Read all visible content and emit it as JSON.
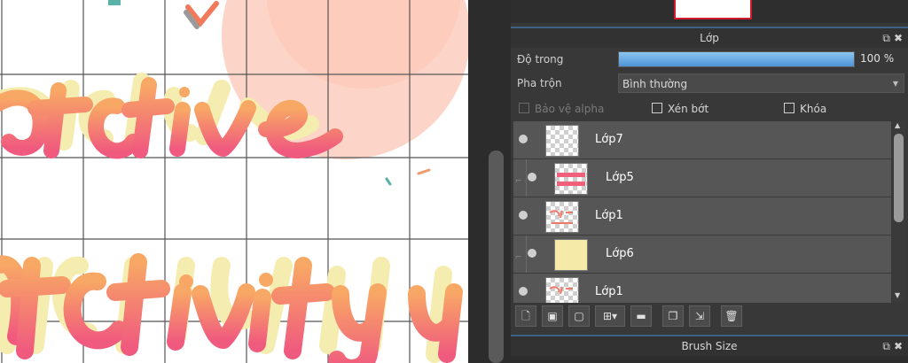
{
  "layer_panel": {
    "title": "Lớp",
    "opacity_label": "Độ trong",
    "opacity_value": "100 %",
    "opacity_level": 1.0,
    "blend_label": "Pha trộn",
    "blend_value": "Bình thường",
    "checkboxes": {
      "protect_alpha": "Bảo vệ alpha",
      "clip": "Xén bớt",
      "lock": "Khóa"
    },
    "layers": [
      {
        "name": "Lớp7",
        "clipped": false
      },
      {
        "name": "Lớp5",
        "clipped": true
      },
      {
        "name": "Lớp1",
        "clipped": false
      },
      {
        "name": "Lớp6",
        "clipped": true
      },
      {
        "name": "Lớp1",
        "clipped": false
      }
    ]
  },
  "brush_panel": {
    "title": "Brush Size"
  },
  "colors": {
    "accent": "#3c5f84",
    "lettering_pink": "#f0607a",
    "lettering_orange": "#f7a06a",
    "shadow_yellow": "#f7eeb0",
    "selection_red": "#d11b2c"
  },
  "icons": {
    "toolbar": [
      "new-layer-icon",
      "new-8bit-layer-icon",
      "new-1bit-layer-icon",
      "add-halftone-layer-icon",
      "new-folder-icon",
      "duplicate-layer-icon",
      "merge-down-icon",
      "delete-layer-icon"
    ],
    "header": [
      "undock-icon",
      "close-icon"
    ]
  }
}
